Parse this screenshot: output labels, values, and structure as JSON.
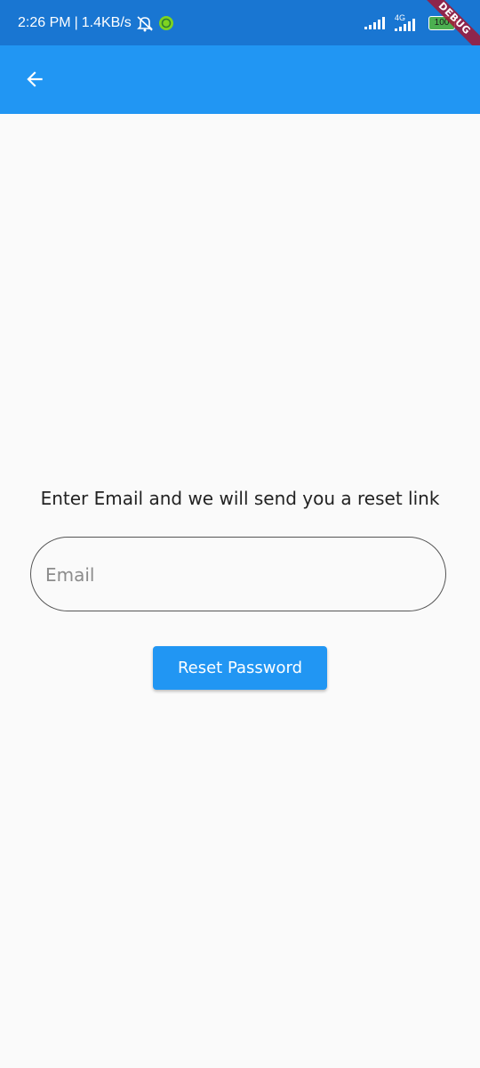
{
  "status_bar": {
    "time": "2:26 PM",
    "separator": "|",
    "net_speed": "1.4KB/s",
    "network_type": "4G",
    "battery": "100",
    "icons": [
      "alarm-off-icon",
      "app-notification-icon",
      "signal-icon",
      "signal-4g-icon",
      "battery-icon"
    ],
    "background_color": "#1976d2"
  },
  "debug_banner": {
    "label": "DEBUG"
  },
  "app_bar": {
    "back_icon": "arrow-back-icon",
    "background_color": "#2196f3"
  },
  "reset_form": {
    "prompt": "Enter Email and we will send you a reset link",
    "email_placeholder": "Email",
    "email_value": "",
    "button_label": "Reset Password",
    "button_color": "#2196f3"
  }
}
